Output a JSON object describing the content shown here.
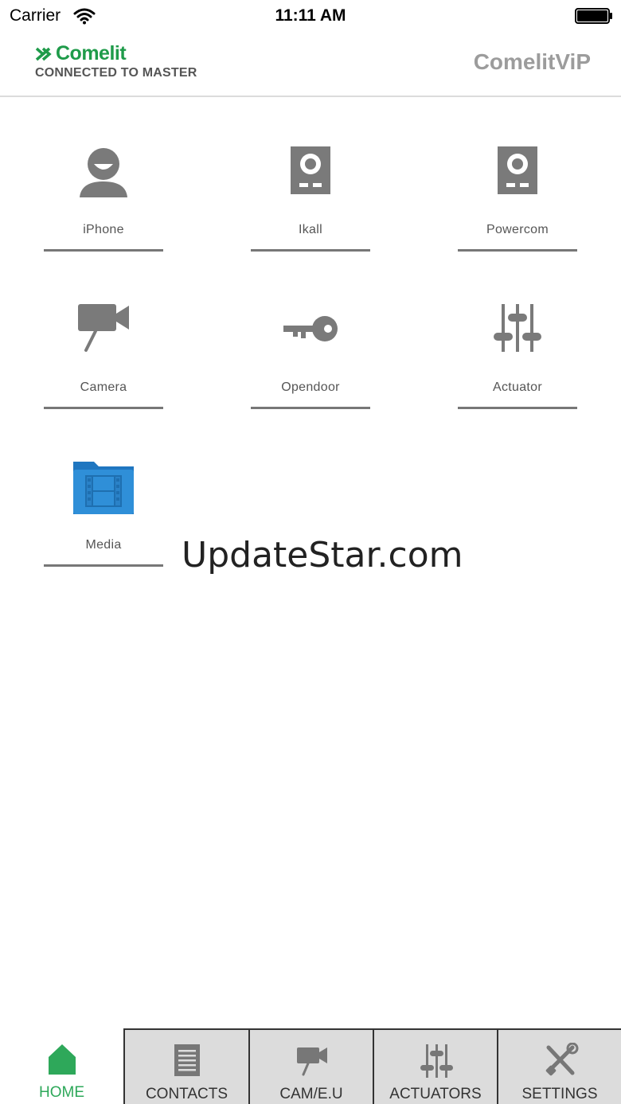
{
  "status_bar": {
    "carrier": "Carrier",
    "time": "11:11 AM"
  },
  "header": {
    "logo_word": "Comelit",
    "subtitle": "CONNECTED TO MASTER",
    "app_title": "ComelitViP"
  },
  "grid": {
    "items": [
      {
        "label": "iPhone",
        "icon": "person-icon"
      },
      {
        "label": "Ikall",
        "icon": "door-entry-panel-icon"
      },
      {
        "label": "Powercom",
        "icon": "door-entry-panel-icon"
      },
      {
        "label": "Camera",
        "icon": "video-camera-icon"
      },
      {
        "label": "Opendoor",
        "icon": "key-icon"
      },
      {
        "label": "Actuator",
        "icon": "sliders-icon"
      },
      {
        "label": "Media",
        "icon": "media-folder-icon"
      }
    ]
  },
  "watermark": "UpdateStar.com",
  "tab_bar": {
    "active": "HOME",
    "tabs": [
      {
        "label": "HOME",
        "icon": "home-icon"
      },
      {
        "label": "CONTACTS",
        "icon": "contacts-list-icon"
      },
      {
        "label": "CAM/E.U",
        "icon": "camera-icon"
      },
      {
        "label": "ACTUATORS",
        "icon": "sliders-icon"
      },
      {
        "label": "SETTINGS",
        "icon": "tools-icon"
      }
    ]
  },
  "colors": {
    "brand_green": "#1f9b4a",
    "active_tab": "#2ea85a",
    "icon_gray": "#7a7a7a",
    "media_blue": "#2f8fd8"
  }
}
